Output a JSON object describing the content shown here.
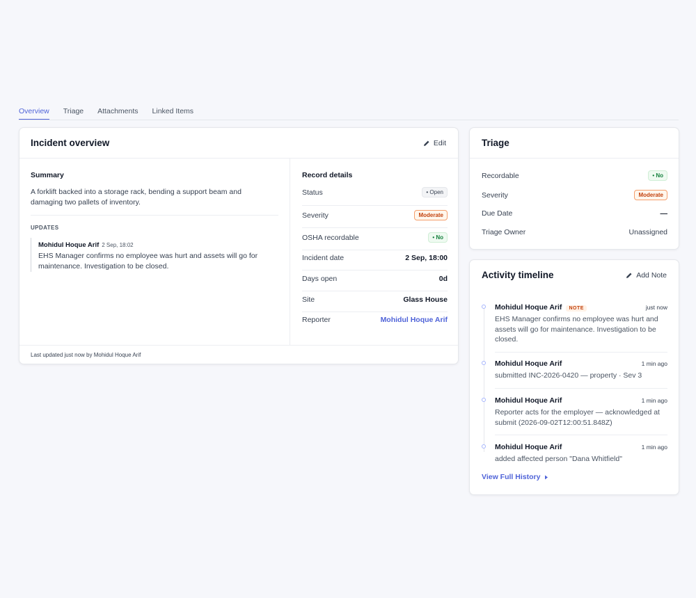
{
  "tabs": [
    "Overview",
    "Triage",
    "Attachments",
    "Linked Items"
  ],
  "incident": {
    "title": "Incident overview",
    "edit_label": "Edit",
    "summary_label": "Summary",
    "summary_text": "A forklift backed into a storage rack, bending a support beam and damaging two pallets of inventory.",
    "updates_label": "UPDATES",
    "update": {
      "author": "Mohidul Hoque Arif",
      "when": "2 Sep, 18:02",
      "text": "EHS Manager confirms no employee was hurt and assets will go for maintenance. Investigation to be closed."
    },
    "record_details_label": "Record details",
    "record": {
      "status_label": "Status",
      "status_value": "• Open",
      "severity_label": "Severity",
      "severity_value": "Moderate",
      "osha_label": "OSHA recordable",
      "osha_value": "• No",
      "incident_date_label": "Incident date",
      "incident_date_value": "2 Sep, 18:00",
      "days_open_label": "Days open",
      "days_open_value": "0d",
      "site_label": "Site",
      "site_value": "Glass House",
      "reporter_label": "Reporter",
      "reporter_value": "Mohidul Hoque Arif"
    },
    "footer": "Last updated just now by Mohidul Hoque Arif"
  },
  "triage": {
    "title": "Triage",
    "recordable_label": "Recordable",
    "recordable_value": "• No",
    "severity_label": "Severity",
    "severity_value": "Moderate",
    "due_label": "Due Date",
    "due_value": "—",
    "owner_label": "Triage Owner",
    "owner_value": "Unassigned"
  },
  "activity": {
    "title": "Activity timeline",
    "add_note_label": "Add Note",
    "items": [
      {
        "author": "Mohidul Hoque Arif",
        "badge": "NOTE",
        "time": "just now",
        "text": "EHS Manager confirms no employee was hurt and assets will go for maintenance. Investigation to be closed."
      },
      {
        "author": "Mohidul Hoque Arif",
        "time": "1 min ago",
        "text": "submitted INC-2026-0420 — property · Sev 3"
      },
      {
        "author": "Mohidul Hoque Arif",
        "time": "1 min ago",
        "text": "Reporter acts for the employer — acknowledged at submit (2026-09-02T12:00:51.848Z)"
      },
      {
        "author": "Mohidul Hoque Arif",
        "time": "1 min ago",
        "text": "added affected person \"Dana Whitfield\""
      }
    ],
    "view_history_label": "View Full History"
  },
  "colors": {
    "accent": "#4f63d8",
    "moderate": "#c2410c",
    "no_green": "#15803d"
  }
}
